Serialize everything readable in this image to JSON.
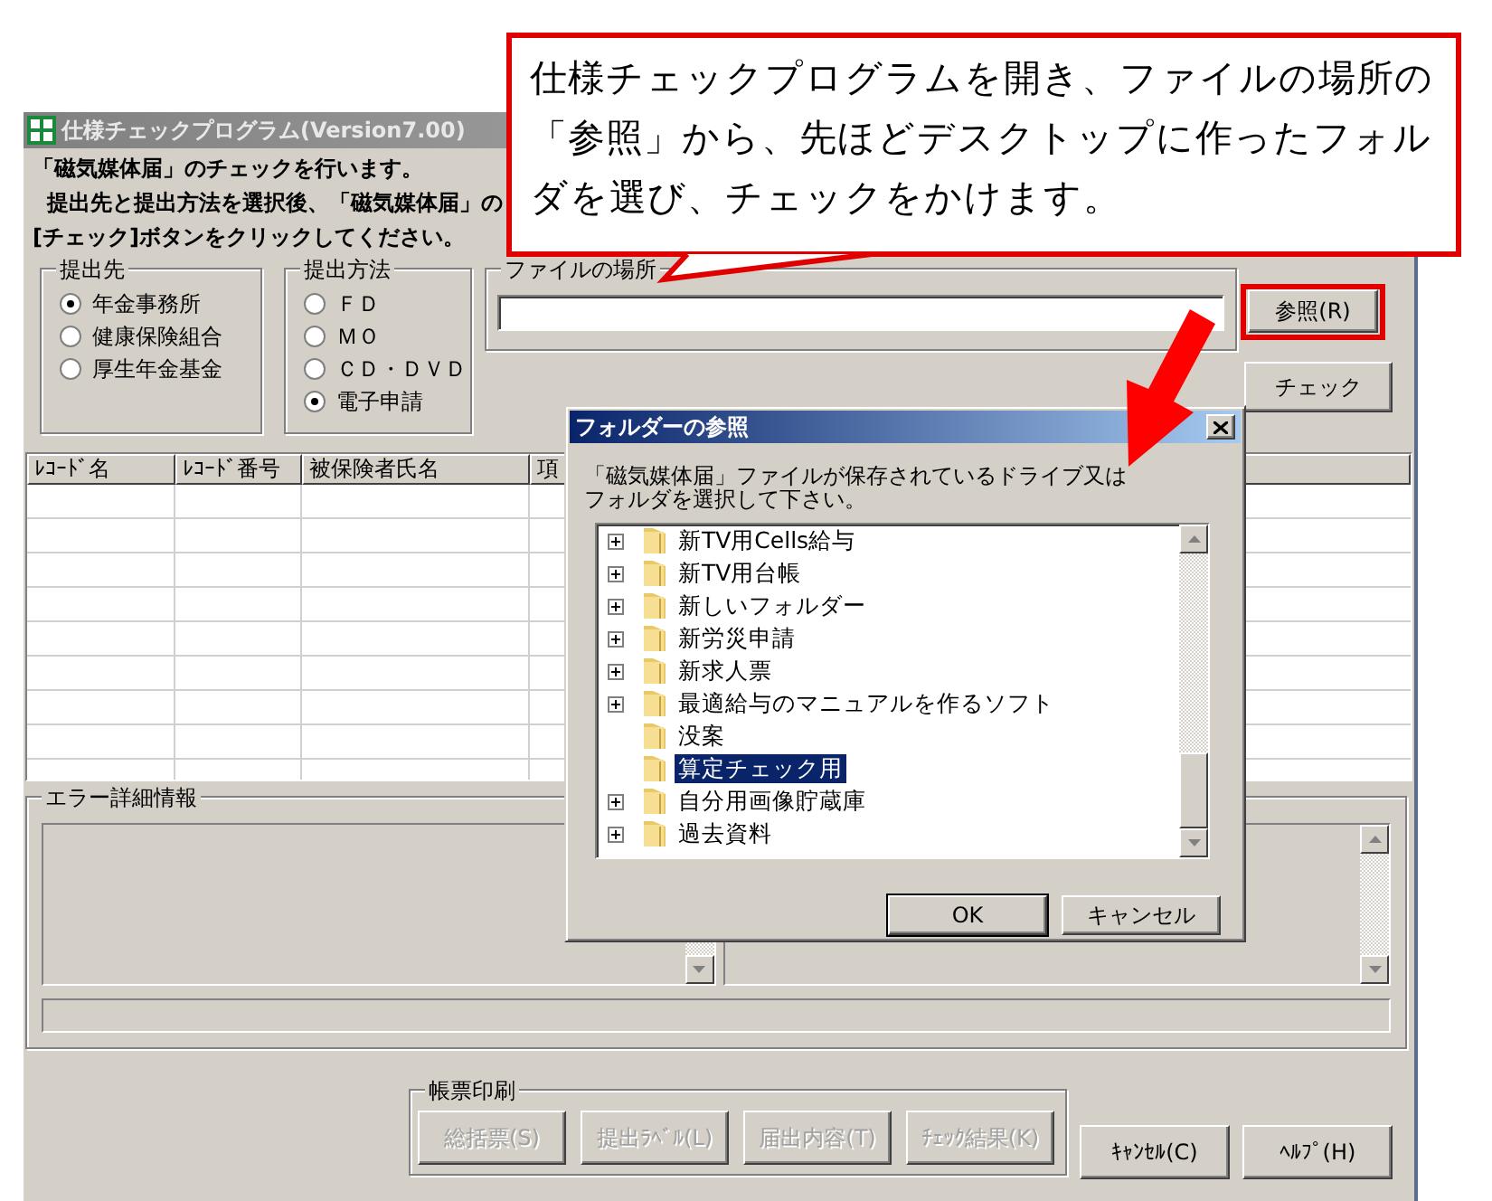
{
  "main_window": {
    "title": "仕様チェックプログラム(Version7.00)",
    "intro": [
      "「磁気媒体届」のチェックを行います。",
      "提出先と提出方法を選択後、「磁気媒体届」の",
      "[チェック]ボタンをクリックしてください。"
    ],
    "submit_to": {
      "label": "提出先",
      "options": [
        {
          "label": "年金事務所",
          "selected": true
        },
        {
          "label": "健康保険組合",
          "selected": false
        },
        {
          "label": "厚生年金基金",
          "selected": false
        }
      ]
    },
    "submit_method": {
      "label": "提出方法",
      "options": [
        {
          "label": "ＦＤ",
          "selected": false
        },
        {
          "label": "ＭＯ",
          "selected": false
        },
        {
          "label": "ＣＤ・ＤＶＤ",
          "selected": false
        },
        {
          "label": "電子申請",
          "selected": true
        }
      ]
    },
    "file_location": {
      "label": "ファイルの場所"
    },
    "browse_button": "参照(R)",
    "check_button": "チェック",
    "table": {
      "columns": [
        "ﾚｺｰﾄﾞ名",
        "ﾚｺｰﾄﾞ番号",
        "被保険者氏名",
        "項"
      ]
    },
    "error_details": {
      "label": "エラー詳細情報"
    },
    "print_forms": {
      "label": "帳票印刷",
      "buttons": [
        {
          "label": "総括票(S)",
          "disabled": true
        },
        {
          "label": "提出ﾗﾍﾞﾙ(L)",
          "disabled": true
        },
        {
          "label": "届出内容(T)",
          "disabled": true
        },
        {
          "label": "ﾁｪｯｸ結果(K)",
          "disabled": true
        }
      ]
    },
    "buttons": [
      "ｷｬﾝｾﾙ(C)",
      "ﾍﾙﾌﾟ(H)"
    ]
  },
  "dialog": {
    "title": "フォルダーの参照",
    "message": [
      "「磁気媒体届」ファイルが保存されているドライブ又は",
      "フォルダを選択して下さい。"
    ],
    "tree": [
      {
        "label": "新TV用Cells給与",
        "expandable": true,
        "selected": false
      },
      {
        "label": "新TV用台帳",
        "expandable": true,
        "selected": false
      },
      {
        "label": "新しいフォルダー",
        "expandable": true,
        "selected": false
      },
      {
        "label": "新労災申請",
        "expandable": true,
        "selected": false
      },
      {
        "label": "新求人票",
        "expandable": true,
        "selected": false
      },
      {
        "label": "最適給与のマニュアルを作るソフト",
        "expandable": true,
        "selected": false
      },
      {
        "label": "没案",
        "expandable": false,
        "selected": false
      },
      {
        "label": "算定チェック用",
        "expandable": false,
        "selected": true
      },
      {
        "label": "自分用画像貯蔵庫",
        "expandable": true,
        "selected": false
      },
      {
        "label": "過去資料",
        "expandable": true,
        "selected": false
      }
    ],
    "buttons": [
      "OK",
      "キャンセル"
    ]
  },
  "callout": {
    "text": "仕様チェックプログラムを開き、ファイルの場所の「参照」から、先ほどデスクトップに作ったフォルダを選び、チェックをかけます。"
  }
}
